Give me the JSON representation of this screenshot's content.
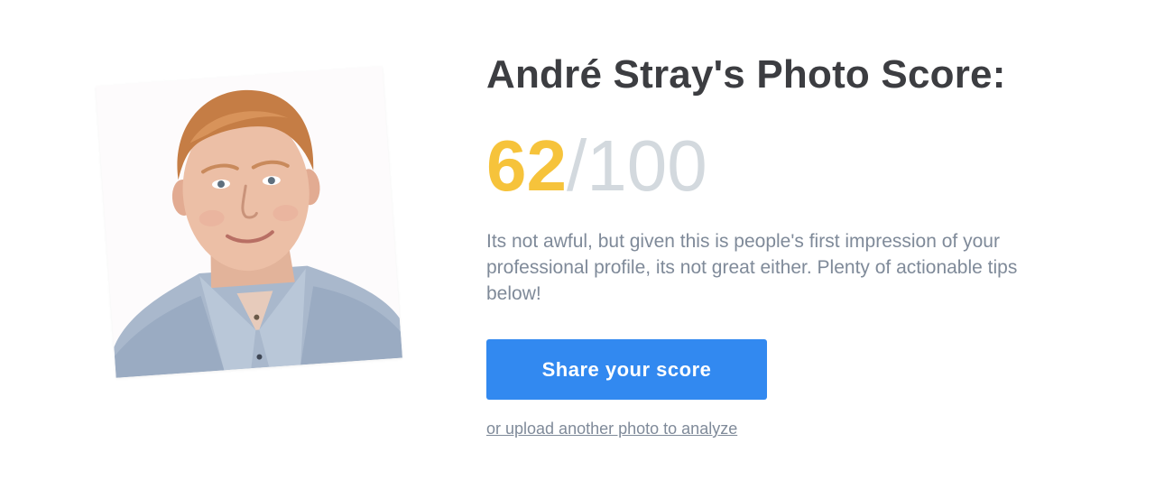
{
  "header": {
    "title": "André Stray's Photo Score:"
  },
  "score": {
    "value": "62",
    "separator": "/",
    "total": "100",
    "value_fraction": 0.62,
    "value_color": "#f6c33b",
    "total_color": "#d3d9de"
  },
  "summary": {
    "text": "Its not awful, but given this is people's first impression of your professional profile, its not great either. Plenty of actionable tips below!"
  },
  "actions": {
    "share_label": "Share your score",
    "share_color": "#3289f0",
    "upload_link_label": "or upload another photo to analyze"
  },
  "photo": {
    "icon": "profile-photo"
  }
}
